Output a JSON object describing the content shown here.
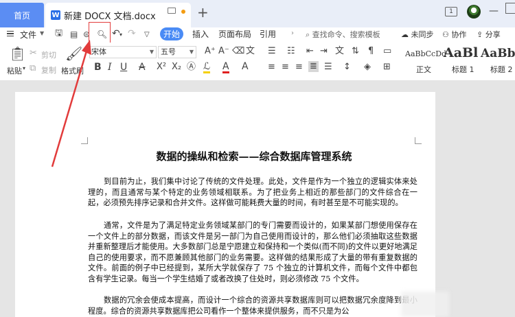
{
  "tabs": {
    "home": "首页",
    "document": "新建 DOCX 文档.docx"
  },
  "topbar": {
    "window_num": "1"
  },
  "menu": {
    "file": "文件"
  },
  "ribbon_tabs": [
    "开始",
    "插入",
    "页面布局",
    "引用"
  ],
  "search_placeholder": "查找命令、搜索模板",
  "status": {
    "unsynced": "未同步",
    "collaborate": "协作",
    "share": "分享"
  },
  "clipboard": {
    "paste": "粘贴",
    "cut": "剪切",
    "copy": "复制",
    "format_painter": "格式刷"
  },
  "font": {
    "family": "宋体",
    "size": "五号"
  },
  "styles": [
    {
      "preview": "AaBbCcDd",
      "label": "正文"
    },
    {
      "preview": "AaBl",
      "label": "标题 1"
    },
    {
      "preview": "AaBb",
      "label": "标题 2"
    }
  ],
  "document": {
    "title": "数据的操纵和检索——综合数据库管理系统",
    "paragraphs": [
      "到目前为止，我们集中讨论了传统的文件处理。此处，文件是作为一个独立的逻辑实体来处理的，而且通常与某个特定的业务领域相联系。为了把业务上相近的那些部门的文件综合在一起，必须预先排序记录和合并文件。这样做可能耗费大量的时间，有时甚至是不可能实现的。",
      "通常，文件是为了满足特定业务领域某部门的专门需要而设计的，如果某部门想使用保存在一个文件上的部分数据，而该文件是另一部门为自己使用而设计的，那么他们必须抽取这些数据并重新整理后才能使用。大多数部门总是宁愿建立和保持和一个类似(而不同)的文件以更好地满足自己的使用要求，而不愿兼顾其他部门的业务需要。这样做的结果形成了大量的带有重复数据的文件。前面的例子中已经提到，某所大学就保存了 75 个独立的计算机文件，而每个文件中都包含有学生记录。每当一个学生结婚了或者改换了住处时，则必须修改 75 个文件。",
      "数据的冗余会使成本提高，而设计一个综合的资源共享数据库则可以把数据冗余度降到最小程度。综合的资源共享数据库把公司看作一个整体来提供服务，而不只是为公"
    ]
  },
  "colors": {
    "accent": "#4a8bf5",
    "home_tab": "#5b8df3",
    "annotation": "#e23b3b",
    "font_color_bar": "#e02020"
  }
}
